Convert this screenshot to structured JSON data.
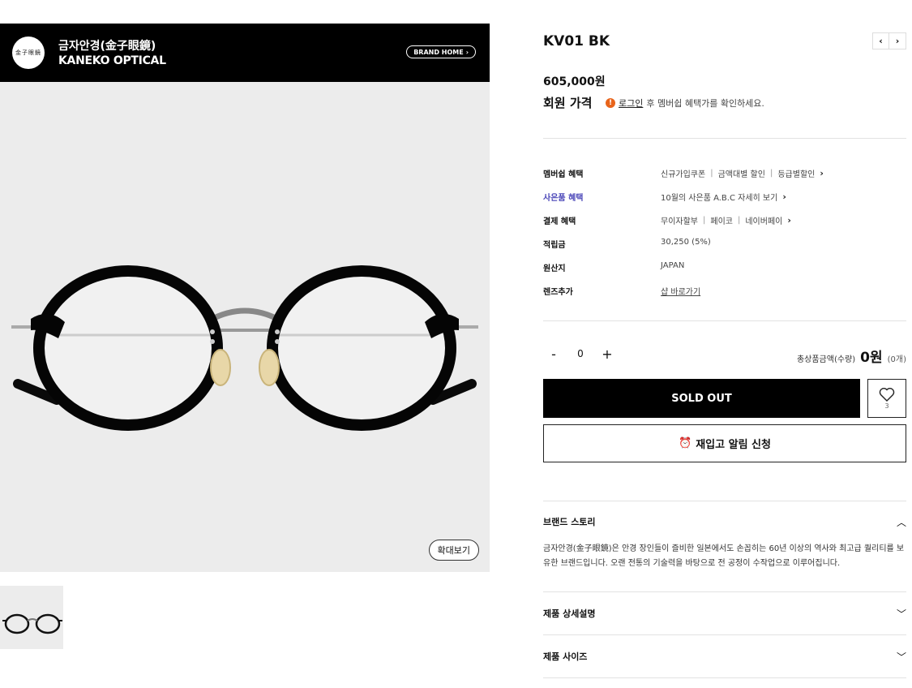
{
  "brand": {
    "logo_text": "金子眼鏡",
    "name_kr": "금자안경(金子眼鏡)",
    "name_en": "KANEKO OPTICAL",
    "home_button": "BRAND HOME"
  },
  "gallery": {
    "zoom_label": "확대보기"
  },
  "product": {
    "title": "KV01 BK",
    "price": "605,000원",
    "member_price_label": "회원 가격",
    "member_note_link": "로그인",
    "member_note_text": "후 멤버쉽 혜택가를 확인하세요.",
    "info": [
      {
        "label": "멤버쉽 혜택",
        "items": [
          "신규가입쿠폰",
          "금액대별 할인",
          "등급별할인"
        ],
        "chevron": true,
        "style": "normal"
      },
      {
        "label": "사은품 혜택",
        "items": [
          "10월의 사은품 A.B.C 자세히 보기"
        ],
        "chevron": true,
        "style": "gift"
      },
      {
        "label": "결제 혜택",
        "items": [
          "무이자할부",
          "페이코",
          "네이버페이"
        ],
        "chevron": true,
        "style": "normal"
      },
      {
        "label": "적립금",
        "items": [
          "30,250 (5%)"
        ],
        "chevron": false,
        "style": "normal"
      },
      {
        "label": "원산지",
        "items": [
          "JAPAN"
        ],
        "chevron": false,
        "style": "normal"
      },
      {
        "label": "렌즈추가",
        "items": [
          "샵 바로가기"
        ],
        "chevron": false,
        "style": "link"
      }
    ]
  },
  "purchase": {
    "minus": "-",
    "qty": "0",
    "plus": "+",
    "total_label": "총상품금액(수량)",
    "total_amount": "0원",
    "total_count": "(0개)",
    "soldout_label": "SOLD OUT",
    "wish_count": "3",
    "restock_label": "재입고 알림 신청"
  },
  "accordion": {
    "brand_story_title": "브랜드 스토리",
    "brand_story_text": "금자안경(金子眼鏡)은 안경 장인들이 즐비한 일본에서도 손꼽히는 60년 이상의 역사와 최고급 퀄리티를 보유한 브랜드입니다. 오랜 전통의 기술력을 바탕으로 전 공정이 수작업으로 이루어집니다.",
    "detail_title": "제품 상세설명",
    "size_title": "제품 사이즈"
  },
  "colors": {
    "gift_label": "#4a46b8",
    "info_dot": "#e8641b"
  }
}
